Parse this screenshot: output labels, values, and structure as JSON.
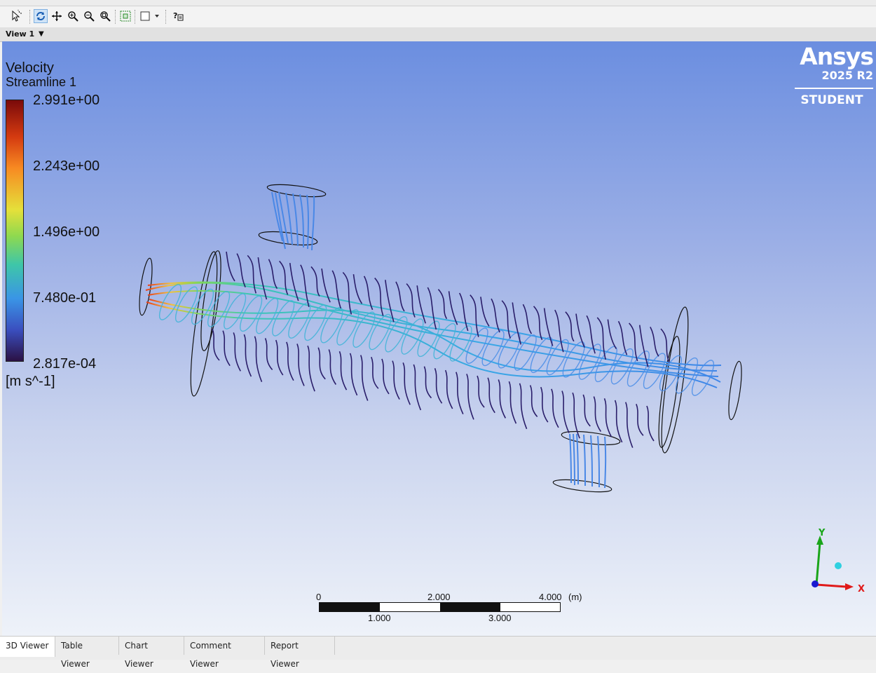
{
  "toolbar": {
    "tools": [
      {
        "icon": "select-icon",
        "active": false
      },
      {
        "icon": "rotate-icon",
        "active": true
      },
      {
        "icon": "pan-icon",
        "active": false
      },
      {
        "icon": "zoom-icon",
        "active": false
      },
      {
        "icon": "zoom-box-icon",
        "active": false
      },
      {
        "icon": "zoom-fit-icon",
        "active": false
      },
      {
        "icon": "fit-view-icon",
        "active": false
      },
      {
        "icon": "viewport-layout-icon",
        "active": false
      },
      {
        "icon": "help-icon",
        "active": false
      }
    ]
  },
  "view": {
    "label": "View 1"
  },
  "legend": {
    "variable": "Velocity",
    "object": "Streamline 1",
    "ticks": [
      "2.991e+00",
      "2.243e+00",
      "1.496e+00",
      "7.480e-01",
      "2.817e-04"
    ],
    "units": "[m s^-1]",
    "max_value": 2.991,
    "min_value": 0.0002817
  },
  "brand": {
    "name": "Ansys",
    "version": "2025 R2",
    "edition": "STUDENT"
  },
  "scalebar": {
    "top_labels": [
      "0",
      "2.000",
      "4.000"
    ],
    "bottom_labels": [
      "1.000",
      "3.000"
    ],
    "unit": "(m)"
  },
  "axes": {
    "x": "X",
    "y": "Y",
    "x_color": "#e01a1a",
    "y_color": "#1aa51a",
    "z_color": "#1a1ad0"
  },
  "tabs": [
    {
      "label": "3D Viewer",
      "active": true
    },
    {
      "label": "Table Viewer",
      "active": false
    },
    {
      "label": "Chart Viewer",
      "active": false
    },
    {
      "label": "Comment Viewer",
      "active": false
    },
    {
      "label": "Report Viewer",
      "active": false
    }
  ]
}
